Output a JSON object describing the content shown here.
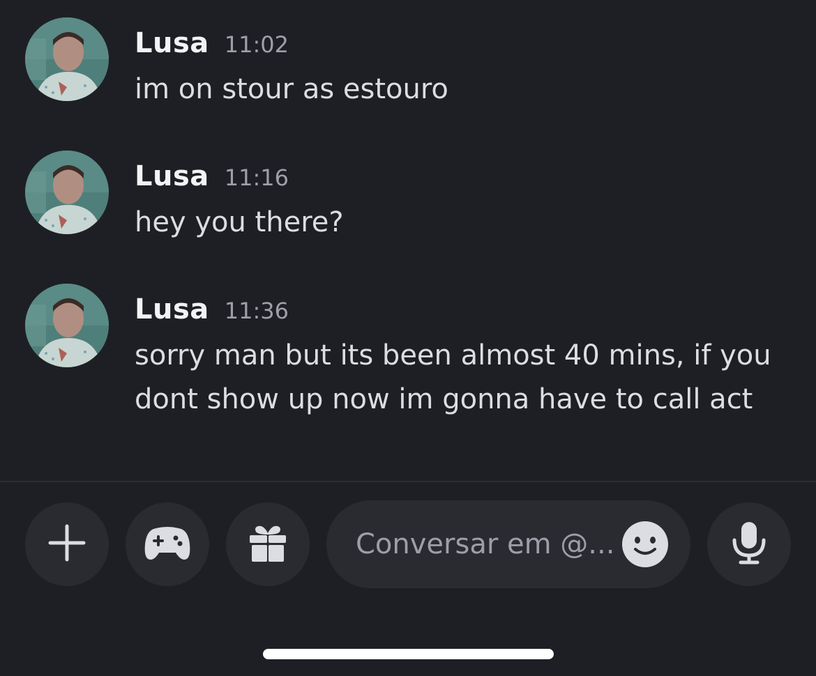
{
  "messages": [
    {
      "author": "Lusa",
      "time": "11:02",
      "text": "im on stour as estouro"
    },
    {
      "author": "Lusa",
      "time": "11:16",
      "text": "hey you there?"
    },
    {
      "author": "Lusa",
      "time": "11:36",
      "text": "sorry man but its been almost 40 mins, if you dont show up now im gonna have to call act"
    }
  ],
  "composer": {
    "placeholder": "Conversar em @...",
    "buttons": [
      "plus-icon",
      "gamepad-icon",
      "gift-icon",
      "emoji-icon",
      "microphone-icon"
    ]
  },
  "colors": {
    "background": "#1e1f24",
    "button": "#2a2b31",
    "icon": "#dcdde2"
  }
}
